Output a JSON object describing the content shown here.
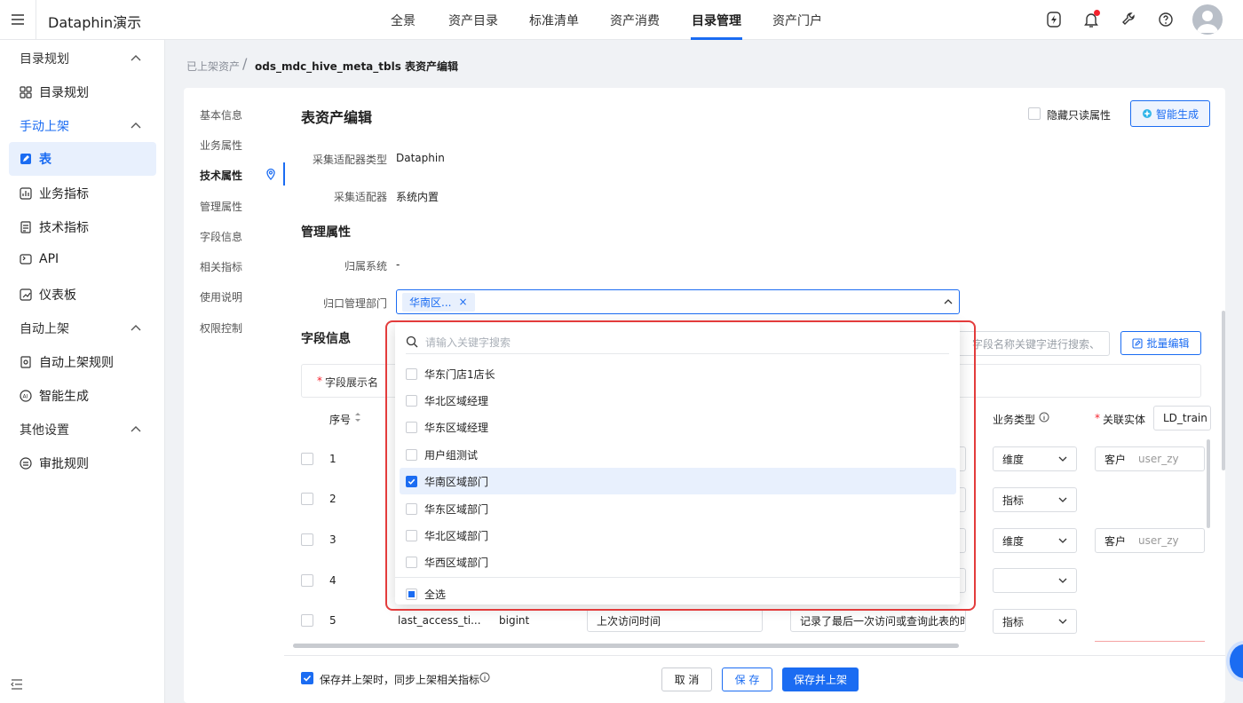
{
  "app": {
    "name": "Dataphin演示"
  },
  "nav": {
    "tabs": [
      "全景",
      "资产目录",
      "标准清单",
      "资产消费",
      "目录管理",
      "资产门户"
    ],
    "active": "目录管理"
  },
  "sidebar": {
    "group1": "目录规划",
    "item_catalog": "目录规划",
    "group2": "手动上架",
    "item_table": "表",
    "item_biz_metric": "业务指标",
    "item_tech_metric": "技术指标",
    "item_api": "API",
    "item_dashboard": "仪表板",
    "group3": "自动上架",
    "item_auto_rule": "自动上架规则",
    "item_smart": "智能生成",
    "group4": "其他设置",
    "item_approval": "审批规则"
  },
  "breadcrumb": {
    "parent": "已上架资产",
    "sep": "/",
    "current": "ods_mdc_hive_meta_tbls 表资产编辑"
  },
  "anchors": [
    "基本信息",
    "业务属性",
    "技术属性",
    "管理属性",
    "字段信息",
    "相关指标",
    "使用说明",
    "权限控制"
  ],
  "page": {
    "title": "表资产编辑",
    "hide_readonly": "隐藏只读属性",
    "smart_gen": "智能生成"
  },
  "tech": {
    "adapter_type_label": "采集适配器类型",
    "adapter_type_value": "Dataphin",
    "adapter_label": "采集适配器",
    "adapter_value": "系统内置"
  },
  "mgmt": {
    "title": "管理属性",
    "system_label": "归属系统",
    "system_value": "-",
    "dept_label": "归口管理部门",
    "dept_tag": "华南区...",
    "dept_tag_close": "×"
  },
  "fields": {
    "title": "字段信息",
    "search_placeholder": "、字段名称关键字进行搜索",
    "batch_edit": "批量编辑",
    "display_name_label": "字段展示名",
    "required_mark": "*",
    "col_seq": "序号",
    "col_biz_type": "业务类型",
    "col_entity": "关联实体",
    "entity_value": "LD_train",
    "rows": [
      {
        "seq": "1",
        "biz_type": "维度",
        "entity_tag": "客户",
        "entity_user": "user_zy"
      },
      {
        "seq": "2",
        "biz_type": "指标",
        "entity_tag": "",
        "entity_user": ""
      },
      {
        "seq": "3",
        "biz_type": "维度",
        "entity_tag": "客户",
        "entity_user": "user_zy"
      },
      {
        "seq": "4",
        "biz_type": "",
        "entity_tag": "",
        "entity_user": ""
      },
      {
        "seq": "5",
        "name": "last_access_ti...",
        "type": "bigint",
        "display": "上次访问时间",
        "desc": "记录了最后一次访问或查询此表的时",
        "biz_type": "指标"
      }
    ]
  },
  "dropdown": {
    "search_placeholder": "请输入关键字搜索",
    "options": [
      {
        "label": "华东门店1店长",
        "checked": false
      },
      {
        "label": "华北区域经理",
        "checked": false
      },
      {
        "label": "华东区域经理",
        "checked": false
      },
      {
        "label": "用户组测试",
        "checked": false
      },
      {
        "label": "华南区域部门",
        "checked": true
      },
      {
        "label": "华东区域部门",
        "checked": false
      },
      {
        "label": "华北区域部门",
        "checked": false
      },
      {
        "label": "华西区域部门",
        "checked": false
      }
    ],
    "select_all": "全选"
  },
  "footer": {
    "sync_label": "保存并上架时，同步上架相关指标",
    "cancel": "取 消",
    "save": "保 存",
    "save_publish": "保存并上架"
  },
  "colors": {
    "primary": "#1b6cf2",
    "highlight_border": "#e33c3c",
    "selected_bg": "#e8f0fd"
  }
}
